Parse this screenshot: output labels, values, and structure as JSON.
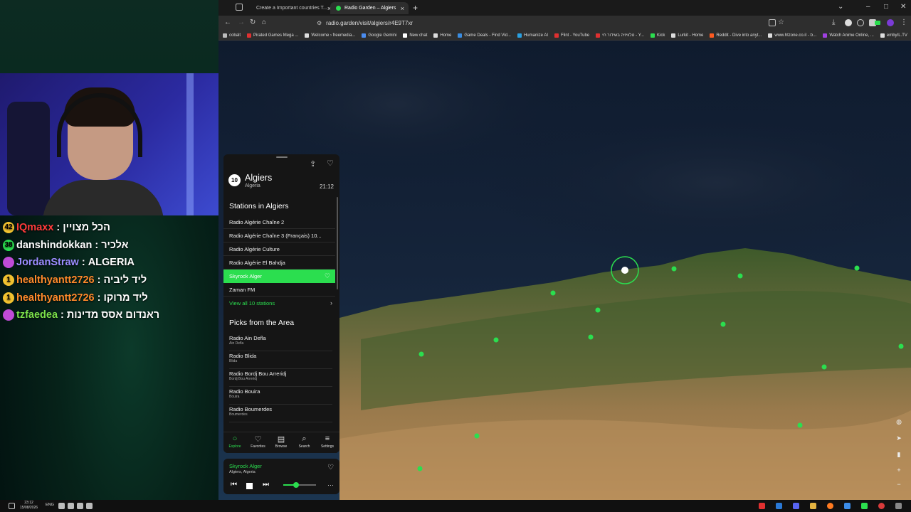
{
  "browser": {
    "tabs": [
      {
        "title": "Create a Important countries T..."
      },
      {
        "title": "Radio Garden – Algiers"
      }
    ],
    "url": "radio.garden/visit/algiers/r4E9T7xr",
    "bookmarks": [
      "cobalt",
      "Pirated Games Mega ...",
      "Welcome › freemedia...",
      "Google Gemini",
      "New chat",
      "Home",
      "Game Deals - Find Vid...",
      "Humanize AI",
      "Flint - YouTube",
      "טלוויזיה בשידור חי - Y...",
      "Kick",
      "Lurkit - Home",
      "Reddit - Dive into anyt...",
      "www.htzone.co.il - ס...",
      "Watch Anime Online, ...",
      "embyIL.TV"
    ]
  },
  "chat": [
    {
      "badge": "42",
      "name": "IQmaxx",
      "name_color": "#ff3b3b",
      "message": "הכל מצויין"
    },
    {
      "badge": "38",
      "name": "danshindokkan",
      "name_color": "#ffffff",
      "message": "אלכיר"
    },
    {
      "badge": "",
      "name": "JordanStraw",
      "name_color": "#9b8cff",
      "message": "ALGERIA"
    },
    {
      "badge": "1",
      "name": "healthyantt2726",
      "name_color": "#ff8a2b",
      "message": "ליד ליביה"
    },
    {
      "badge": "1",
      "name": "healthyantt2726",
      "name_color": "#ff8a2b",
      "message": "ליד מרוקו"
    },
    {
      "badge": "",
      "name": "tzfaedea",
      "name_color": "#7be04a",
      "message": "ראנדום אסס מדינות"
    }
  ],
  "panel": {
    "city_badge": "10",
    "city": "Algiers",
    "country": "Algeria",
    "time": "21:12",
    "stations_heading": "Stations in Algiers",
    "stations": [
      "Radio Algérie Chaîne 2",
      "Radio Algérie Chaîne 3 (Français) 10...",
      "Radio Algérie Culture",
      "Radio Algérie El Bahdja",
      "Skyrock Alger",
      "Zaman FM"
    ],
    "active_station": "Skyrock Alger",
    "view_all": "View all 10 stations",
    "picks_heading": "Picks from the Area",
    "picks": [
      {
        "name": "Radio Ain Defla",
        "place": "Ain Defla"
      },
      {
        "name": "Radio Blida",
        "place": "Blida"
      },
      {
        "name": "Radio Bordj Bou Arreridj",
        "place": "Bordj Bou Arreridj"
      },
      {
        "name": "Radio Bouira",
        "place": "Bouira"
      },
      {
        "name": "Radio Boumerdes",
        "place": "Boumerdes"
      }
    ],
    "nav": [
      "Explore",
      "Favorites",
      "Browse",
      "Search",
      "Settings"
    ]
  },
  "player": {
    "station": "Skyrock Alger",
    "location": "Algiers, Algeria",
    "volume": 0.4
  },
  "taskbar": {
    "time": "23:12",
    "date": "15/08/2026",
    "lang": "ENG"
  },
  "colors": {
    "accent": "#2bde4f",
    "panel_bg": "#151515"
  }
}
